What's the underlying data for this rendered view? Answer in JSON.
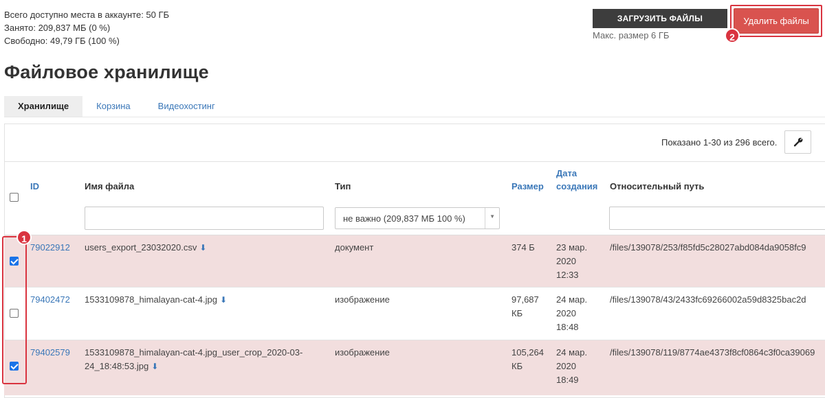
{
  "account": {
    "total": "Всего доступно места в аккаунте: 50 ГБ",
    "used": "Занято: 209,837 МБ (0 %)",
    "free": "Свободно: 49,79 ГБ (100 %)"
  },
  "toolbar": {
    "upload_label": "ЗАГРУЗИТЬ ФАЙЛЫ",
    "upload_hint": "Макс. размер 6 ГБ",
    "delete_label": "Удалить файлы"
  },
  "annotations": {
    "badge1": "1",
    "badge2": "2"
  },
  "page": {
    "title": "Файловое хранилище"
  },
  "tabs": [
    {
      "label": "Хранилище",
      "active": true
    },
    {
      "label": "Корзина",
      "active": false
    },
    {
      "label": "Видеохостинг",
      "active": false
    }
  ],
  "table": {
    "summary": "Показано 1-30 из 296 всего.",
    "columns": {
      "id": "ID",
      "name": "Имя файла",
      "type": "Тип",
      "size": "Размер",
      "created_line1": "Дата",
      "created_line2": "создания",
      "path": "Относительный путь"
    },
    "filters": {
      "type_selected": "не важно (209,837 МБ 100 %)"
    },
    "rows": [
      {
        "checked": true,
        "id": "79022912",
        "name_line1": "users_export_23032020.csv",
        "name_line2": "",
        "type": "документ",
        "size_line1": "374 Б",
        "size_line2": "",
        "date_line1": "23 мар.",
        "date_line2": "2020",
        "date_line3": "12:33",
        "path": "/files/139078/253/f85fd5c28027abd084da9058fc9"
      },
      {
        "checked": false,
        "id": "79402472",
        "name_line1": "1533109878_himalayan-cat-4.jpg",
        "name_line2": "",
        "type": "изображение",
        "size_line1": "97,687",
        "size_line2": "КБ",
        "date_line1": "24 мар.",
        "date_line2": "2020",
        "date_line3": "18:48",
        "path": "/files/139078/43/2433fc69266002a59d8325bac2d"
      },
      {
        "checked": true,
        "id": "79402579",
        "name_line1": "1533109878_himalayan-cat-4.jpg_user_crop_2020-03-",
        "name_line2": "24_18:48:53.jpg",
        "type": "изображение",
        "size_line1": "105,264",
        "size_line2": "КБ",
        "date_line1": "24 мар.",
        "date_line2": "2020",
        "date_line3": "18:49",
        "path": "/files/139078/119/8774ae4373f8cf0864c3f0ca39069"
      }
    ]
  },
  "icons": {
    "wrench": "wrench-icon",
    "download": "download-icon",
    "caret": "chevron-down-icon"
  },
  "colors": {
    "delete": "#d9534f",
    "highlight": "#d9333f",
    "selected_row": "#f2dede",
    "link": "#3a77b8",
    "upload": "#3d3d3d",
    "checkbox": "#1a73e8"
  }
}
